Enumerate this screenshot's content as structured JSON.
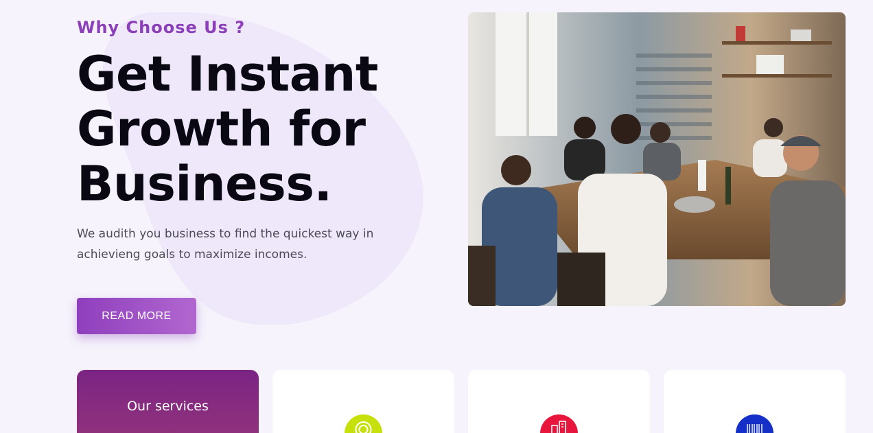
{
  "hero": {
    "eyebrow": "Why Choose Us ?",
    "headline_line1": "Get Instant",
    "headline_line2": "Growth for",
    "headline_line3": "Business.",
    "description": "We audith you business to find the quickest way in achievieng goals to maximize incomes.",
    "cta_label": "READ MORE"
  },
  "services": {
    "title": "Our services",
    "icons": [
      "target-icon",
      "city-buildings-icon",
      "barcode-icon"
    ]
  },
  "colors": {
    "accent": "#8b3fb8",
    "cta_start": "#8f3fbd",
    "cta_end": "#b167cf",
    "services_card_top": "#7b2484",
    "services_card_bottom": "#96357a",
    "icon_lime": "#c6e00b",
    "icon_red": "#e8163c",
    "icon_blue": "#1530c8",
    "background": "#f6f3fc"
  }
}
